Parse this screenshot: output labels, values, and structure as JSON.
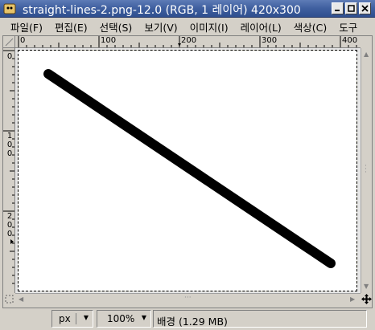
{
  "window": {
    "title": "straight-lines-2.png-12.0 (RGB, 1 레이어) 420x300",
    "controls": [
      "minimize",
      "maximize",
      "close"
    ]
  },
  "menu": {
    "items": [
      "파일(F)",
      "편집(E)",
      "선택(S)",
      "보기(V)",
      "이미지(I)",
      "레이어(L)",
      "색상(C)",
      "도구"
    ]
  },
  "rulers": {
    "horizontal_labels": [
      "0",
      "100",
      "200",
      "300",
      "400"
    ],
    "vertical_labels": [
      "0",
      "100",
      "200"
    ]
  },
  "status": {
    "unit": "px",
    "zoom": "100%",
    "info": "배경 (1.29 MB)"
  },
  "colors": {
    "titlebar": "#3f5f9f",
    "chrome": "#d4d0c8",
    "canvas": "#ffffff",
    "stroke": "#000000"
  },
  "icons": [
    "gimp-app-icon",
    "minimize-icon",
    "maximize-icon",
    "close-icon",
    "quick-mask-icon",
    "navigate-icon",
    "chevron-down-icon"
  ]
}
